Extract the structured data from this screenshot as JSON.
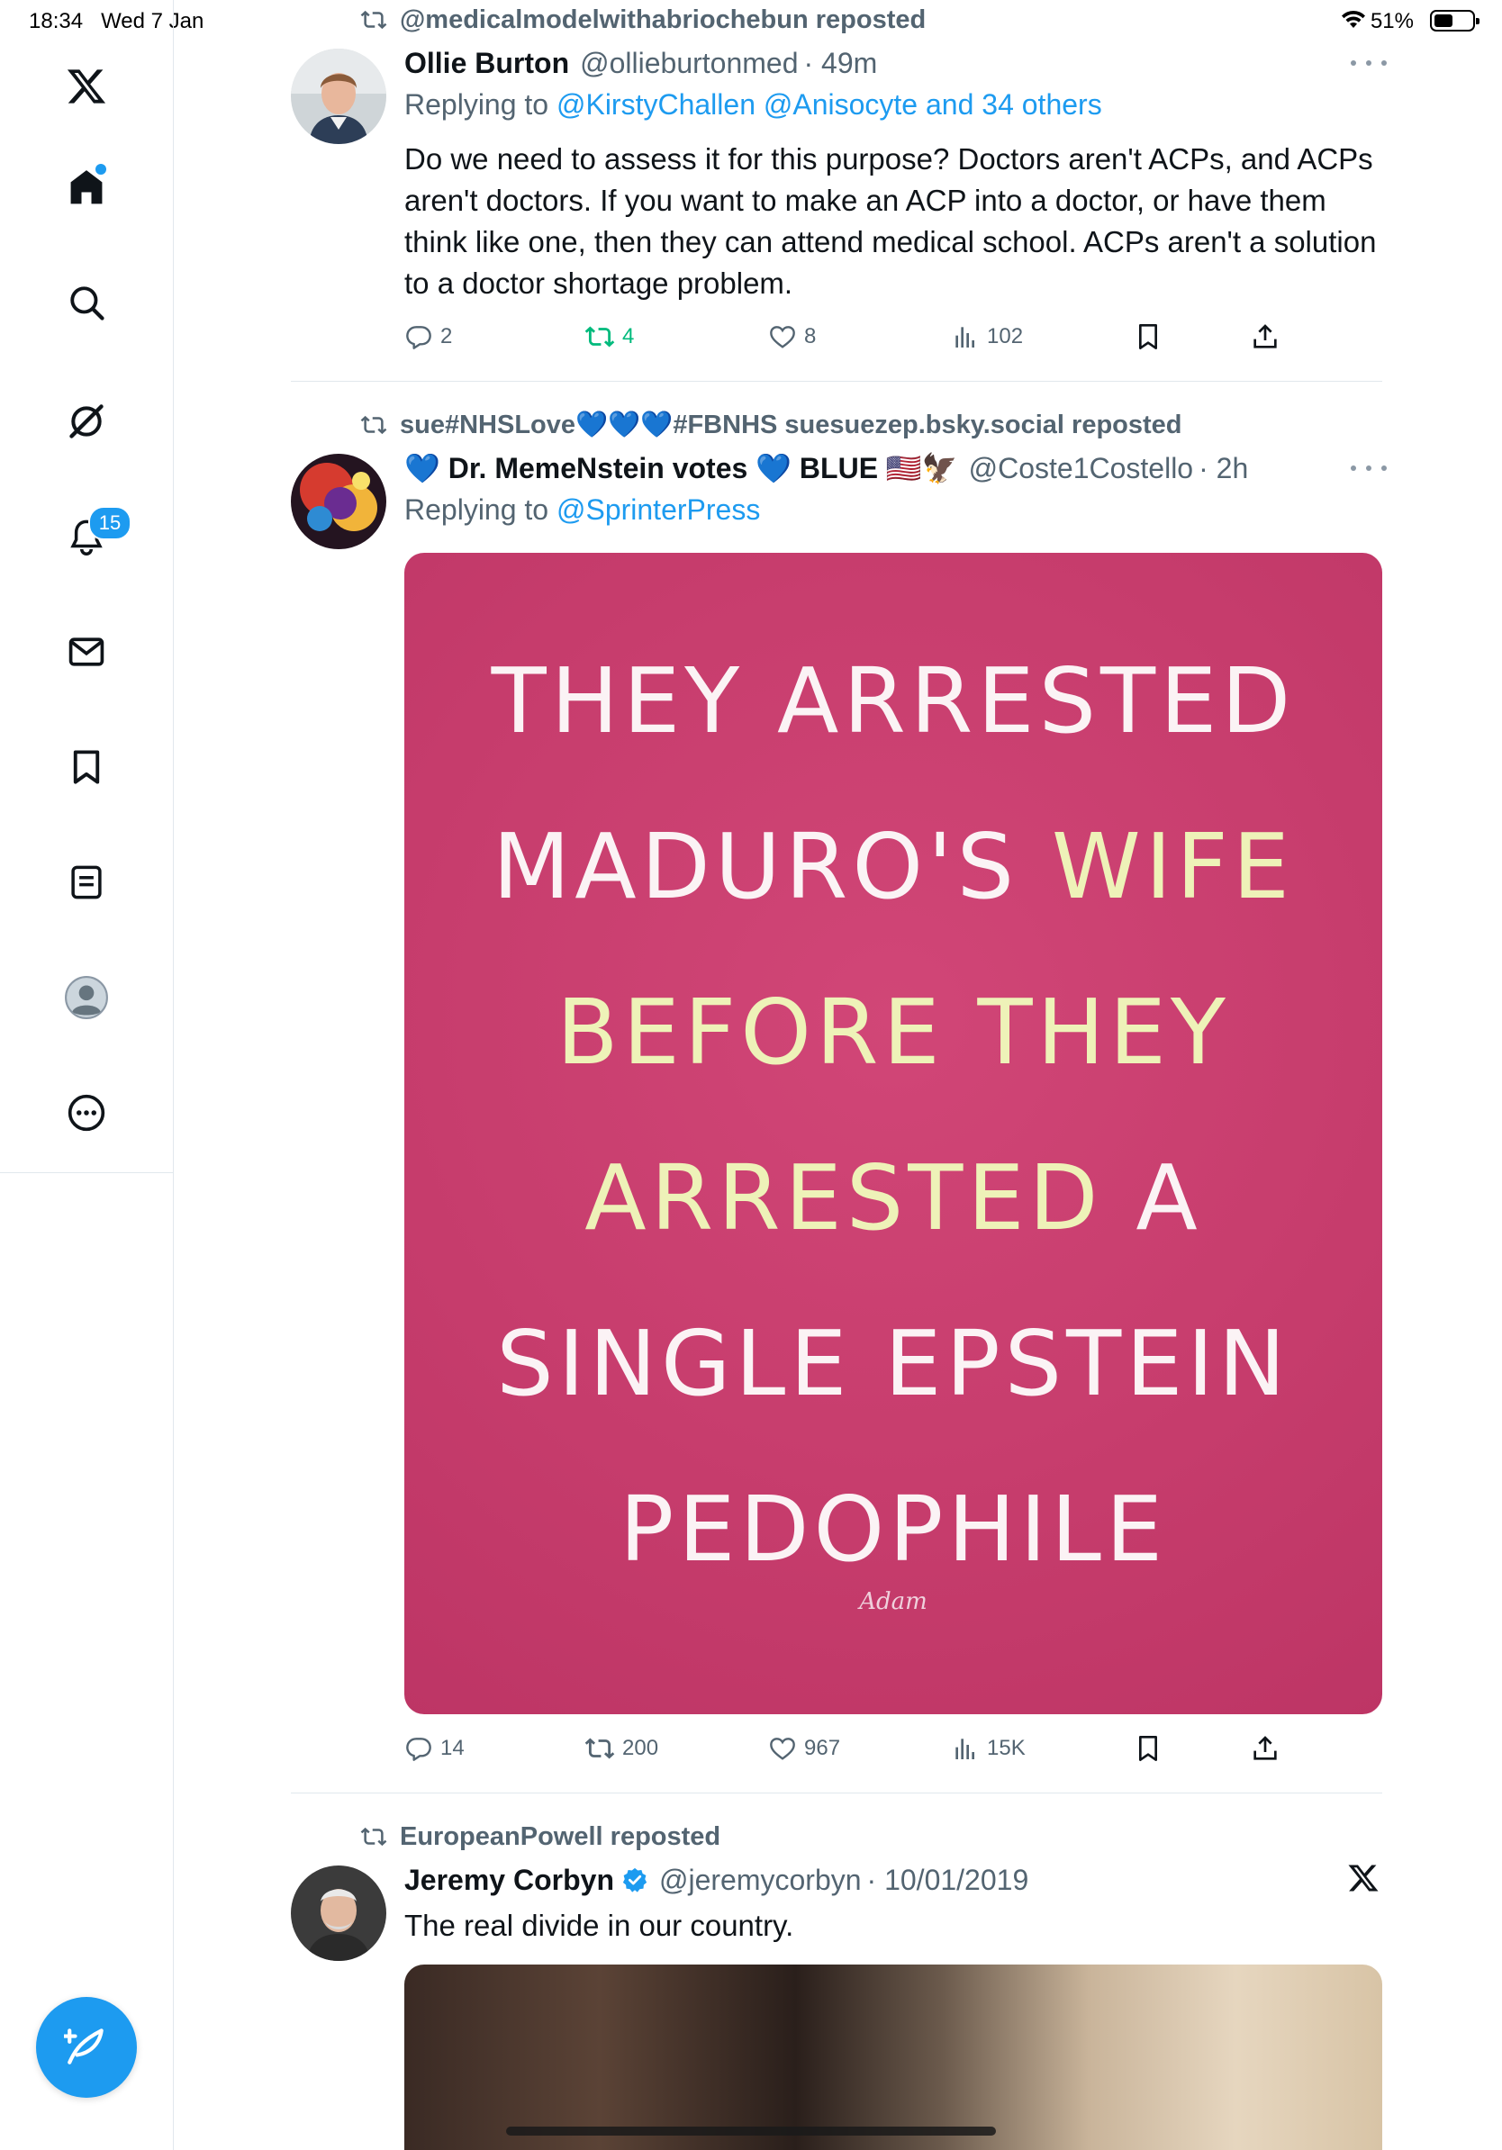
{
  "status_bar": {
    "time": "18:34",
    "date": "Wed 7 Jan",
    "battery_percent": "51%",
    "battery_level": 0.51
  },
  "sidebar": {
    "items": [
      {
        "icon": "x-logo-icon"
      },
      {
        "icon": "home-icon",
        "has_dot": true
      },
      {
        "icon": "search-icon"
      },
      {
        "icon": "grok-icon"
      },
      {
        "icon": "notifications-icon",
        "badge": "15"
      },
      {
        "icon": "messages-icon"
      },
      {
        "icon": "bookmarks-icon"
      },
      {
        "icon": "lists-icon"
      },
      {
        "icon": "profile-icon"
      },
      {
        "icon": "more-icon"
      }
    ],
    "compose": {
      "icon": "compose-icon"
    }
  },
  "tweets": [
    {
      "repost_by": "@medicalmodelwithabriochebun reposted",
      "name": "Ollie Burton",
      "handle": "@ollieburtonmed",
      "time": "· 49m",
      "replying_prefix": "Replying to",
      "replying_to": "@KirstyChallen @Anisocyte and 34 others",
      "text": "Do we need to assess it for this purpose? Doctors aren't ACPs, and ACPs aren't doctors. If you want to make an ACP into a doctor, or have them think like one, then they can attend medical school. ACPs aren't a solution to a doctor shortage problem.",
      "replies": "2",
      "reposts": "4",
      "likes": "8",
      "views": "102"
    },
    {
      "repost_by": "sue#NHSLove💙💙💙#FBNHS suesuezep.bsky.social reposted",
      "name": "💙 Dr. MemeNstein votes 💙 BLUE 🇺🇸🦅",
      "handle": "@Coste1Costello",
      "time": "· 2h",
      "replying_prefix": "Replying to",
      "replying_to": "@SprinterPress",
      "image_text": {
        "line1": "THEY ARRESTED",
        "line2a": "MADURO'S ",
        "line2b": "WIFE",
        "line3": "BEFORE THEY",
        "line4a": "ARRESTED",
        "line4b": " A",
        "line5": "SINGLE EPSTEIN",
        "line6": "PEDOPHILE",
        "credit": "Adam"
      },
      "replies": "14",
      "reposts": "200",
      "likes": "967",
      "views": "15K"
    },
    {
      "repost_by": "EuropeanPowell reposted",
      "name": "Jeremy Corbyn",
      "handle": "@jeremycorbyn",
      "time": "· 10/01/2019",
      "verified": true,
      "text": "The real divide in our country."
    }
  ],
  "colors": {
    "accent": "#1d9bf0",
    "secondary_text": "#536471",
    "repost_green": "#00ba7c",
    "meme_bg": "#c63c6c",
    "meme_highlight": "#eef2b8"
  }
}
